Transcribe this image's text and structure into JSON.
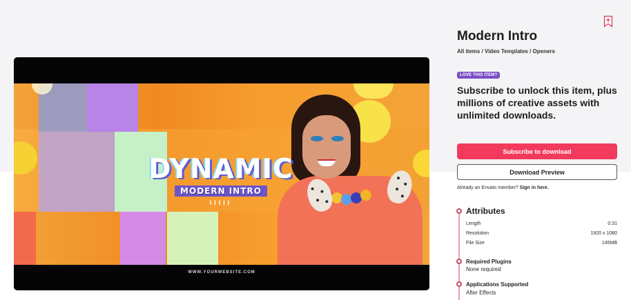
{
  "item": {
    "title": "Modern Intro",
    "breadcrumbs": [
      "All items",
      "Video Templates",
      "Openers"
    ],
    "breadcrumb_separator": " / ",
    "badge": "LOVE THIS ITEM?",
    "pitch": "Subscribe to unlock this item, plus millions of creative assets with unlimited downloads.",
    "subscribe_label": "Subscribe to download",
    "preview_label": "Download Preview",
    "member_prefix": "Already an Envato member?",
    "member_link": "Sign in here."
  },
  "video": {
    "title_main": "DYNAMIC",
    "title_sub": "MODERN INTRO",
    "title_bars": "IIIII",
    "website": "WWW.YOURWEBSITE.COM"
  },
  "attributes": {
    "heading": "Attributes",
    "rows": [
      {
        "label": "Length",
        "value": "0:31"
      },
      {
        "label": "Resolution",
        "value": "1920 x 1080"
      },
      {
        "label": "File Size",
        "value": "145MB"
      }
    ]
  },
  "plugins": {
    "heading": "Required Plugins",
    "value": "None required"
  },
  "apps": {
    "heading": "Applications Supported",
    "value": "After Effects"
  },
  "colors": {
    "accent": "#f23a5c",
    "badge": "#7b4fc6",
    "timeline": "#c64b66"
  },
  "icons": {
    "bookmark": "bookmark-plus-icon"
  }
}
